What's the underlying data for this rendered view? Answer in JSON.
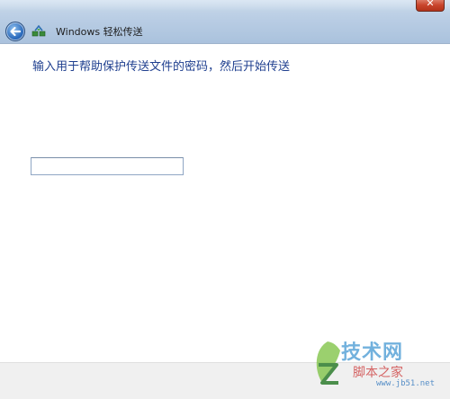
{
  "window": {
    "title": "Windows 轻松传送",
    "close_glyph": "✕"
  },
  "main": {
    "heading": "输入用于帮助保护传送文件的密码，然后开始传送",
    "password": {
      "value": "",
      "placeholder": ""
    }
  },
  "watermark": {
    "brand": "技术网",
    "sub": "脚本之家",
    "url": "www.jb51.net"
  },
  "colors": {
    "heading": "#1f3f8f",
    "titlebar": "#b9cde4",
    "footer": "#f0f0f0"
  },
  "icons": {
    "back": "back-arrow-icon",
    "app": "easy-transfer-icon",
    "close": "close-icon"
  }
}
